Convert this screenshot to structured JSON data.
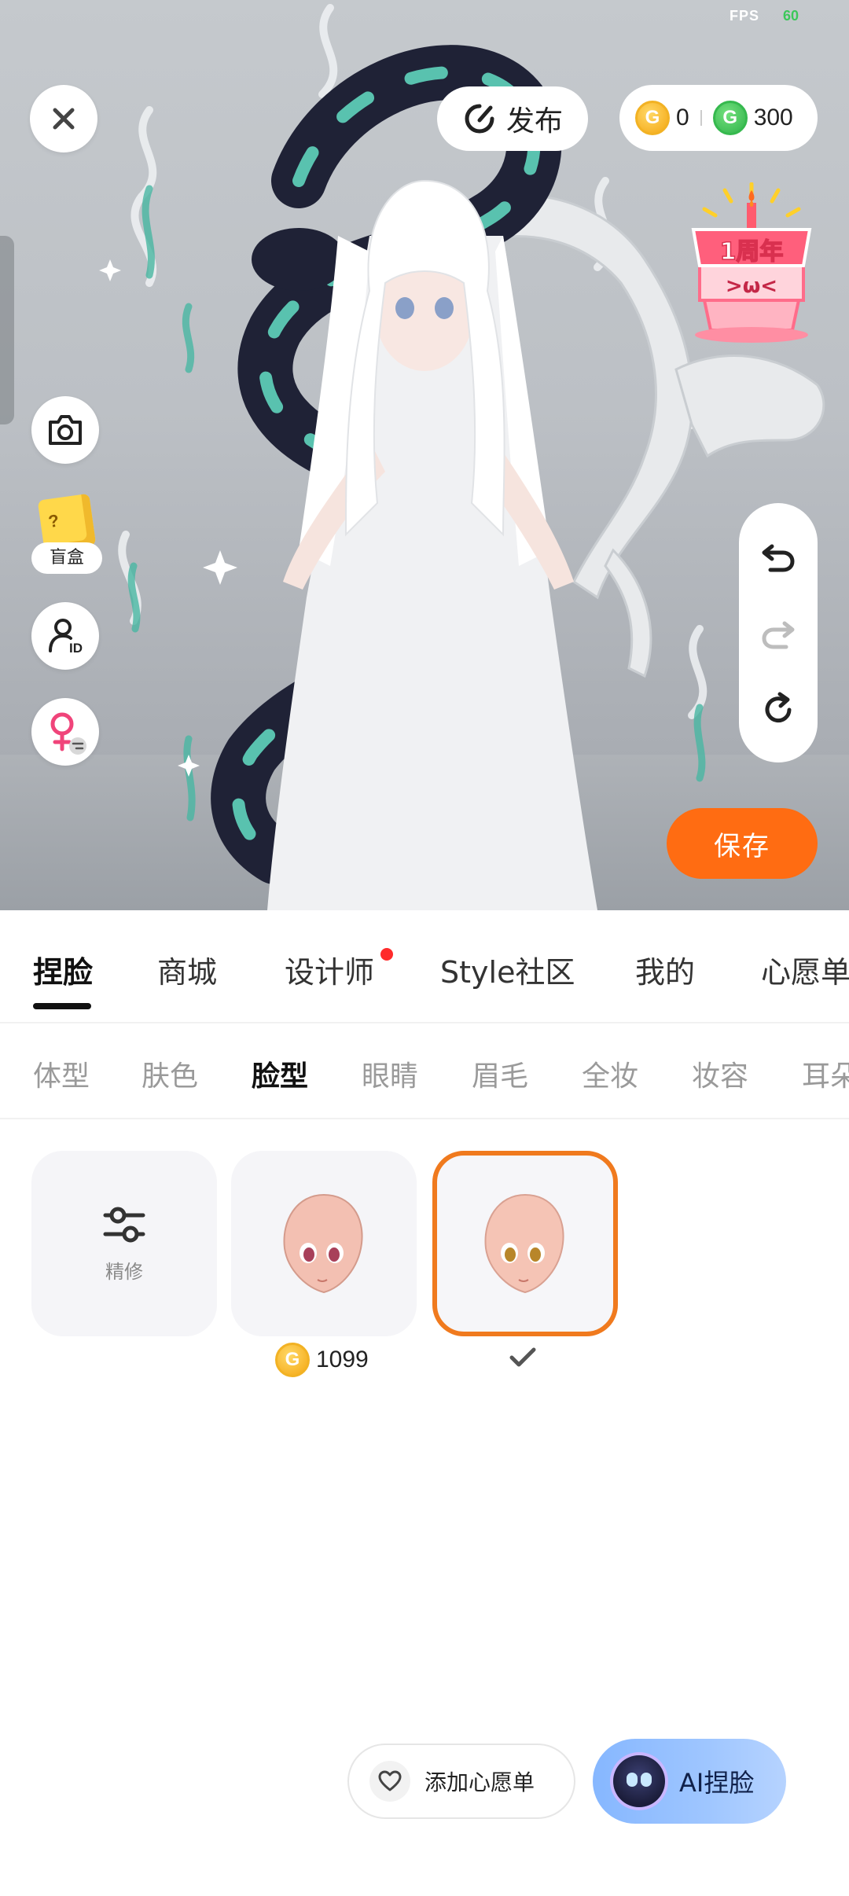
{
  "status": {
    "fps_label": "FPS",
    "fps_value": "60"
  },
  "top_bar": {
    "publish_label": "发布",
    "gold_coins": "0",
    "green_coins": "300",
    "coin_glyph": "G"
  },
  "event_badge": {
    "title": "1周年",
    "face": ">ω<"
  },
  "left_tools": {
    "blindbox_label": "盲盒"
  },
  "history": {
    "undo": "undo-icon",
    "redo": "redo-icon",
    "reset": "reset-icon"
  },
  "save_label": "保存",
  "main_tabs": [
    {
      "label": "捏脸",
      "active": true
    },
    {
      "label": "商城"
    },
    {
      "label": "设计师",
      "badge": true
    },
    {
      "label": "Style社区"
    },
    {
      "label": "我的"
    },
    {
      "label": "心愿单"
    }
  ],
  "sub_tabs": [
    {
      "label": "体型"
    },
    {
      "label": "肤色"
    },
    {
      "label": "脸型",
      "active": true
    },
    {
      "label": "眼睛"
    },
    {
      "label": "眉毛"
    },
    {
      "label": "全妆"
    },
    {
      "label": "妆容"
    },
    {
      "label": "耳朵"
    }
  ],
  "items": {
    "refine_label": "精修",
    "item1_price": "1099"
  },
  "bottom": {
    "wishlist_label": "添加心愿单",
    "ai_label": "AI捏脸"
  },
  "colors": {
    "accent_orange": "#ff6c12",
    "selected_border": "#f07a1e",
    "coin_gold": "#f4a712",
    "coin_green": "#2fb34a",
    "badge_red": "#ff2b2b"
  }
}
